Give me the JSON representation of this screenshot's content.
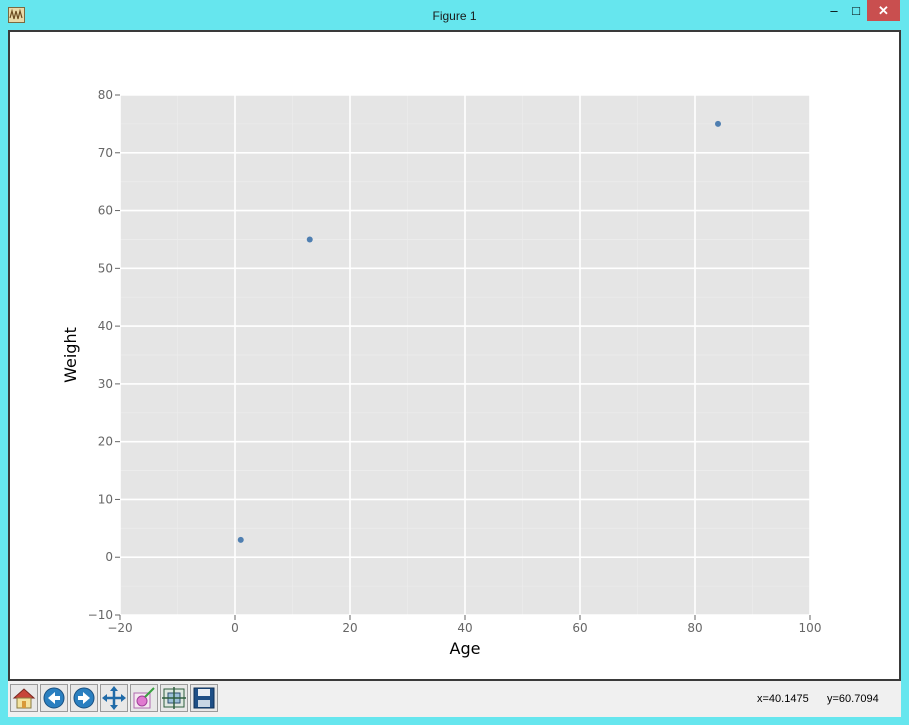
{
  "window": {
    "title": "Figure 1",
    "controls": {
      "minimize": "–",
      "maximize": "□",
      "close": "✕"
    }
  },
  "toolbar": {
    "buttons": [
      {
        "icon": "home-icon"
      },
      {
        "icon": "back-arrow-icon"
      },
      {
        "icon": "forward-arrow-icon"
      },
      {
        "icon": "pan-icon"
      },
      {
        "icon": "zoom-icon"
      },
      {
        "icon": "configure-subplots-icon"
      },
      {
        "icon": "save-icon"
      }
    ],
    "coord_x": "x=40.1475",
    "coord_y": "y=60.7094"
  },
  "chart_data": {
    "type": "scatter",
    "title": "",
    "xlabel": "Age",
    "ylabel": "Weight",
    "xlim": [
      -20,
      100
    ],
    "ylim": [
      -10,
      80
    ],
    "xticks": [
      -20,
      0,
      20,
      40,
      60,
      80,
      100
    ],
    "yticks": [
      -10,
      0,
      10,
      20,
      30,
      40,
      50,
      60,
      70,
      80
    ],
    "xtick_labels": [
      "−20",
      "0",
      "20",
      "40",
      "60",
      "80",
      "100"
    ],
    "ytick_labels": [
      "−10",
      "0",
      "10",
      "20",
      "30",
      "40",
      "50",
      "60",
      "70",
      "80"
    ],
    "grid": true,
    "series": [
      {
        "x": [
          1,
          13,
          84
        ],
        "y": [
          3,
          55,
          75
        ]
      }
    ],
    "colors": {
      "background": "#e5e5e5",
      "grid": "#ffffff",
      "point": "#4f7fb1",
      "tick": "#666666"
    }
  }
}
